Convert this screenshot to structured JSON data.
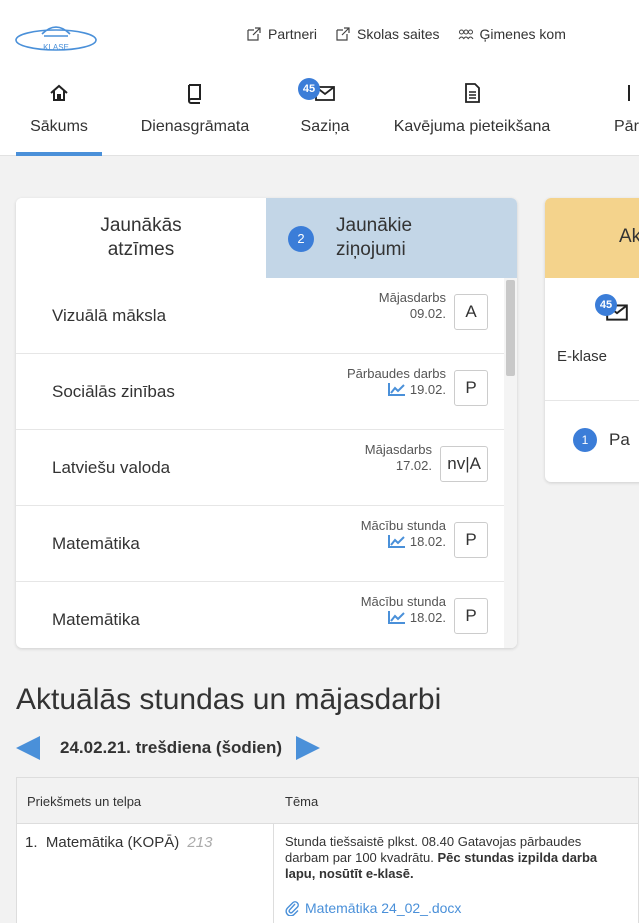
{
  "header": {
    "logo_text": "KLASE",
    "links": [
      {
        "label": "Partneri",
        "icon": "external-link-icon"
      },
      {
        "label": "Skolas saites",
        "icon": "external-link-icon"
      },
      {
        "label": "Ģimenes kom",
        "icon": "family-icon"
      }
    ]
  },
  "nav": {
    "items": [
      {
        "label": "Sākums",
        "icon": "home-icon",
        "active": true
      },
      {
        "label": "Dienasgrāmata",
        "icon": "book-icon"
      },
      {
        "label": "Saziņa",
        "icon": "mail-icon",
        "badge": "45"
      },
      {
        "label": "Kavējuma pieteikšana",
        "icon": "document-icon"
      },
      {
        "label": "Pār",
        "icon": "more-icon"
      }
    ]
  },
  "marks_card": {
    "tab1": {
      "line1": "Jaunākās",
      "line2": "atzīmes"
    },
    "tab2": {
      "line1": "Jaunākie",
      "line2": "ziņojumi",
      "badge": "2"
    },
    "rows": [
      {
        "subject": "Vizuālā māksla",
        "type": "Mājasdarbs",
        "date": "09.02.",
        "grade": "A",
        "trend": false
      },
      {
        "subject": "Sociālās zinības",
        "type": "Pārbaudes darbs",
        "date": "19.02.",
        "grade": "P",
        "trend": true
      },
      {
        "subject": "Latviešu valoda",
        "type": "Mājasdarbs",
        "date": "17.02.",
        "grade": "nv|A",
        "trend": false
      },
      {
        "subject": "Matemātika",
        "type": "Mācību stunda",
        "date": "18.02.",
        "grade": "P",
        "trend": true
      },
      {
        "subject": "Matemātika",
        "type": "Mācību stunda",
        "date": "18.02.",
        "grade": "P",
        "trend": true
      }
    ]
  },
  "right_card": {
    "title": "Ak",
    "badge": "45",
    "label": "E-klase",
    "item_badge": "1",
    "item_text": "Pa"
  },
  "lessons": {
    "title": "Aktuālās stundas un mājasdarbi",
    "date": "24.02.21. trešdiena (šodien)",
    "headers": [
      "Priekšmets un telpa",
      "Tēma"
    ],
    "rows": [
      {
        "num": "1.",
        "subject": "Matemātika (KOPĀ)",
        "room": "213",
        "topic": "Stunda tiešsaistē plkst. 08.40 Gatavojas pārbaudes darbam par 100 kvadrātu.",
        "topic_bold": "Pēc stundas izpilda darba lapu, nosūtīt e-klasē.",
        "attachment": "Matemātika 24_02_.docx"
      }
    ]
  },
  "colors": {
    "accent": "#4a90d9",
    "tab_active_bg": "#c3d6e7",
    "card_head": "#f4d38c",
    "badge": "#3b7dd8"
  }
}
